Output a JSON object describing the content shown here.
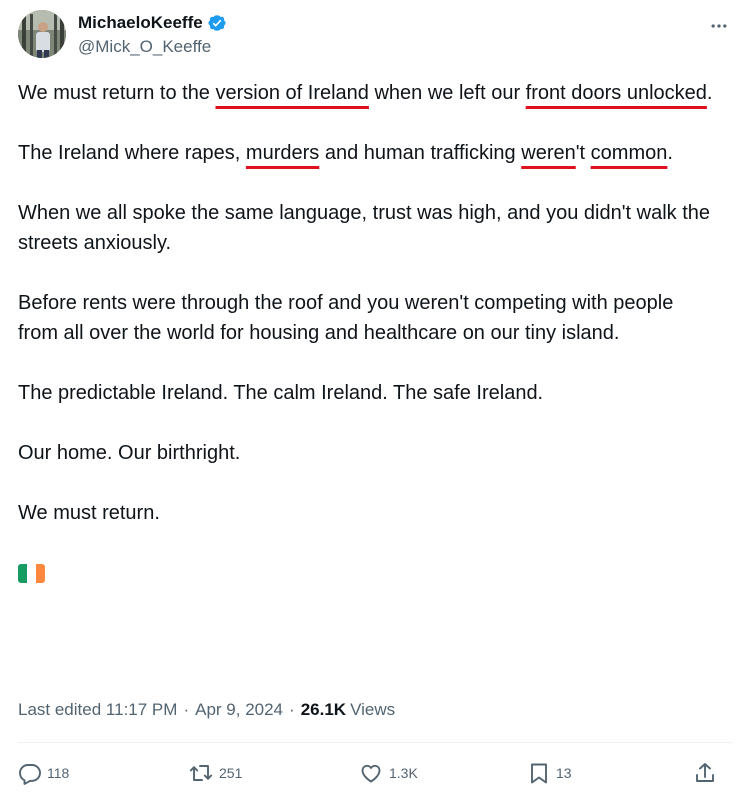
{
  "author": {
    "display_name": "MichaeloKeeffe",
    "handle": "@Mick_O_Keeffe",
    "verified": true
  },
  "paragraphs": [
    [
      {
        "text": "We must return to the "
      },
      {
        "text": "version of Ireland",
        "underline": true
      },
      {
        "text": " when we left our "
      },
      {
        "text": "front doors unlocked",
        "underline": true
      },
      {
        "text": "."
      }
    ],
    [
      {
        "text": "The Ireland where rapes, "
      },
      {
        "text": "murders",
        "underline": true
      },
      {
        "text": " and human trafficking "
      },
      {
        "text": "weren",
        "underline": true
      },
      {
        "text": "'t "
      },
      {
        "text": "common",
        "underline": true
      },
      {
        "text": "."
      }
    ],
    [
      {
        "text": "When we all spoke the same language, trust was high, and you didn't walk the streets anxiously."
      }
    ],
    [
      {
        "text": "Before rents were through the roof and you weren't competing with people from all over the world for housing and healthcare on our tiny island."
      }
    ],
    [
      {
        "text": "The predictable Ireland. The calm Ireland. The safe Ireland."
      }
    ],
    [
      {
        "text": "Our home. Our birthright."
      }
    ],
    [
      {
        "text": "We must return."
      }
    ]
  ],
  "flag": {
    "name": "ireland-flag",
    "colors": [
      "#169b62",
      "#ffffff",
      "#ff883e"
    ]
  },
  "meta": {
    "edited_label": "Last edited",
    "time": "11:17 PM",
    "date": "Apr 9, 2024",
    "views_count": "26.1K",
    "views_label": "Views"
  },
  "actions": {
    "replies": "118",
    "reposts": "251",
    "likes": "1.3K",
    "bookmarks": "13"
  },
  "colors": {
    "text": "#0f1419",
    "secondary": "#536471",
    "verified": "#1d9bf0",
    "underline_annotation": "#e0101e"
  }
}
